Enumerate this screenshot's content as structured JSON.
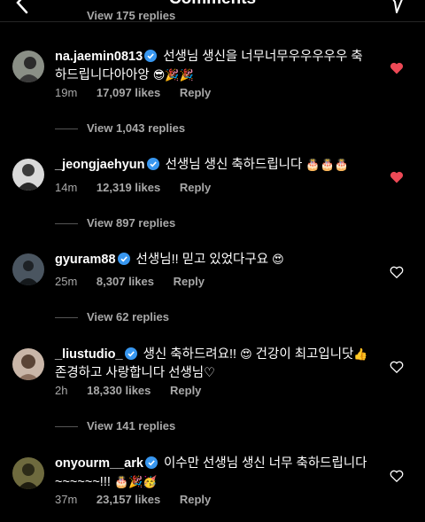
{
  "header": {
    "title": "Comments",
    "top_view_replies": "View 175 replies",
    "back_icon": "back-arrow-icon",
    "share_icon": "direct-share-icon"
  },
  "comments": [
    {
      "username": "na.jaemin0813",
      "verified": true,
      "text": "선생님 생신을 너무너무우우우우우 축하드립니다아아앙",
      "emojis": "😎🎉🎉",
      "time": "19m",
      "likes": "17,097 likes",
      "reply": "Reply",
      "liked": true,
      "view_replies": "View 1,043 replies"
    },
    {
      "username": "_jeongjaehyun",
      "verified": true,
      "text": "선생님 생신 축하드립니다",
      "emojis": "🎂🎂🎂",
      "time": "14m",
      "likes": "12,319 likes",
      "reply": "Reply",
      "liked": true,
      "view_replies": "View 897 replies"
    },
    {
      "username": "gyuram88",
      "verified": true,
      "text": "선생님!! 믿고 있었다구요",
      "emojis": "😍",
      "time": "25m",
      "likes": "8,307 likes",
      "reply": "Reply",
      "liked": false,
      "view_replies": "View 62 replies"
    },
    {
      "username": "_liustudio_",
      "verified": true,
      "text": "생신 축하드려요!!",
      "text2": "건강이 최고입니닷",
      "text3": "존경하고 사랑합니다 선생님♡",
      "emoji_mid": "😍",
      "emoji_mid2": "👍",
      "time": "2h",
      "likes": "18,330 likes",
      "reply": "Reply",
      "liked": false,
      "view_replies": "View 141 replies"
    },
    {
      "username": "onyourm__ark",
      "verified": true,
      "text": "이수만 선생님 생신 너무 축하드립니다 ~~~~~~!!!",
      "emojis": "🎂🎉🥳",
      "time": "37m",
      "likes": "23,157 likes",
      "reply": "Reply",
      "liked": false
    }
  ],
  "colors": {
    "background": "#000000",
    "text": "#ffffff",
    "secondary_text": "#a8a8a8",
    "verified_badge": "#3897f0",
    "liked_heart": "#ed4956"
  }
}
